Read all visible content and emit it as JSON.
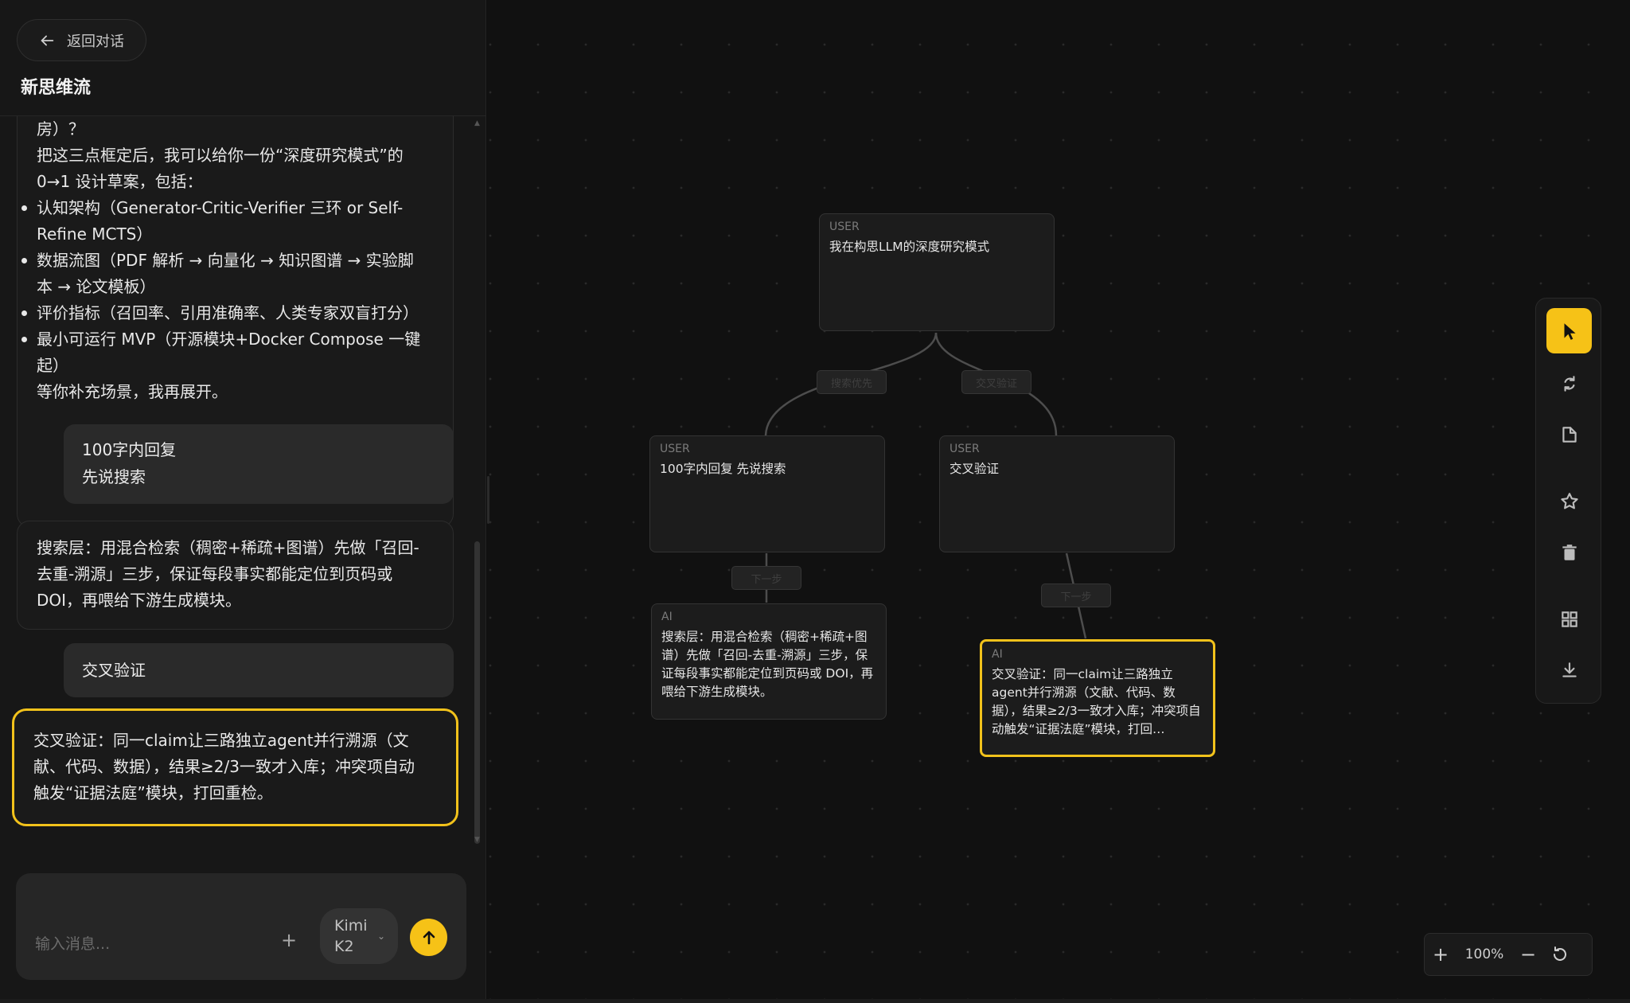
{
  "sidebar": {
    "back_label": "返回对话",
    "title": "新思维流"
  },
  "messages": {
    "ai_1": {
      "lines_intro": [
        "房）？",
        "把这三点框定后，我可以给你一份“深度研究模式”的",
        "0→1 设计草案，包括："
      ],
      "bullets": [
        [
          "认知架构（Generator-Critic-Verifier 三环 or Self-",
          "Refine MCTS）"
        ],
        [
          "数据流图（PDF 解析 → 向量化 → 知识图谱 → 实验脚",
          "本 → 论文模板）"
        ],
        [
          "评价指标（召回率、引用准确率、人类专家双盲打分）"
        ],
        [
          "最小可运行 MVP（开源模块+Docker Compose 一键",
          "起）"
        ]
      ],
      "outro": "等你补充场景，我再展开。"
    },
    "user_1": [
      "100字内回复",
      "先说搜索"
    ],
    "ai_2": [
      "搜索层：用混合检索（稠密+稀疏+图谱）先做「召回-",
      "去重-溯源」三步，保证每段事实都能定位到页码或",
      "DOI，再喂给下游生成模块。"
    ],
    "user_2": [
      "交叉验证"
    ],
    "ai_3": [
      "交叉验证：同一claim让三路独立agent并行溯源（文",
      "献、代码、数据），结果≥2/3一致才入库；冲突项自动",
      "触发“证据法庭”模块，打回重检。"
    ]
  },
  "composer": {
    "placeholder": "输入消息...",
    "add_label": "+",
    "model_label": "Kimi K2",
    "model_chevron": "⌄"
  },
  "graph": {
    "root": {
      "role": "USER",
      "text": "我在构思LLM的深度研究模式"
    },
    "left_user": {
      "role": "USER",
      "text": "100字内回复 先说搜索"
    },
    "right_user": {
      "role": "USER",
      "text": "交叉验证"
    },
    "left_ai": {
      "role": "AI",
      "text": "搜索层：用混合检索（稠密+稀疏+图谱）先做「召回-去重-溯源」三步，保证每段事实都能定位到页码或 DOI，再喂给下游生成模块。"
    },
    "right_ai": {
      "role": "AI",
      "text": "交叉验证：同一claim让三路独立agent并行溯源（文献、代码、数据），结果≥2/3一致才入库；冲突项自动触发“证据法庭”模块，打回…"
    },
    "edge_labels": {
      "root_left": "搜索优先",
      "root_right": "交叉验证",
      "left_down": "下一步",
      "right_down": "下一步"
    }
  },
  "toolbar": {
    "tools": [
      "pointer-icon",
      "swap-icon",
      "page-icon",
      "star-icon",
      "trash-icon",
      "grid-icon",
      "download-icon"
    ],
    "active": "pointer-icon"
  },
  "zoom": {
    "zoom_in": "+",
    "value": "100%",
    "zoom_out": "−"
  },
  "colors": {
    "accent": "#f6c217",
    "background": "#111111",
    "panel": "#171717"
  }
}
